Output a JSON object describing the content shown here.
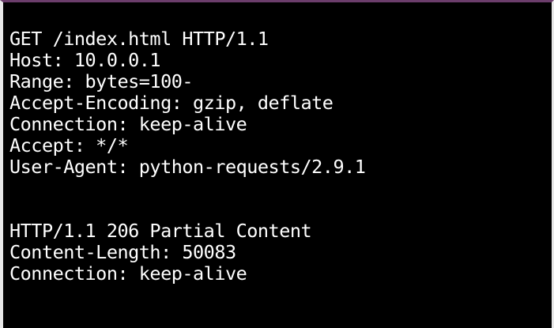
{
  "terminal": {
    "lines": [
      "GET /index.html HTTP/1.1",
      "Host: 10.0.0.1",
      "Range: bytes=100-",
      "Accept-Encoding: gzip, deflate",
      "Connection: keep-alive",
      "Accept: */*",
      "User-Agent: python-requests/2.9.1",
      "",
      "",
      "HTTP/1.1 206 Partial Content",
      "Content-Length: 50083",
      "Connection: keep-alive"
    ]
  },
  "colors": {
    "background": "#000000",
    "text": "#ffffff",
    "top_border": "#6b3d6b"
  }
}
